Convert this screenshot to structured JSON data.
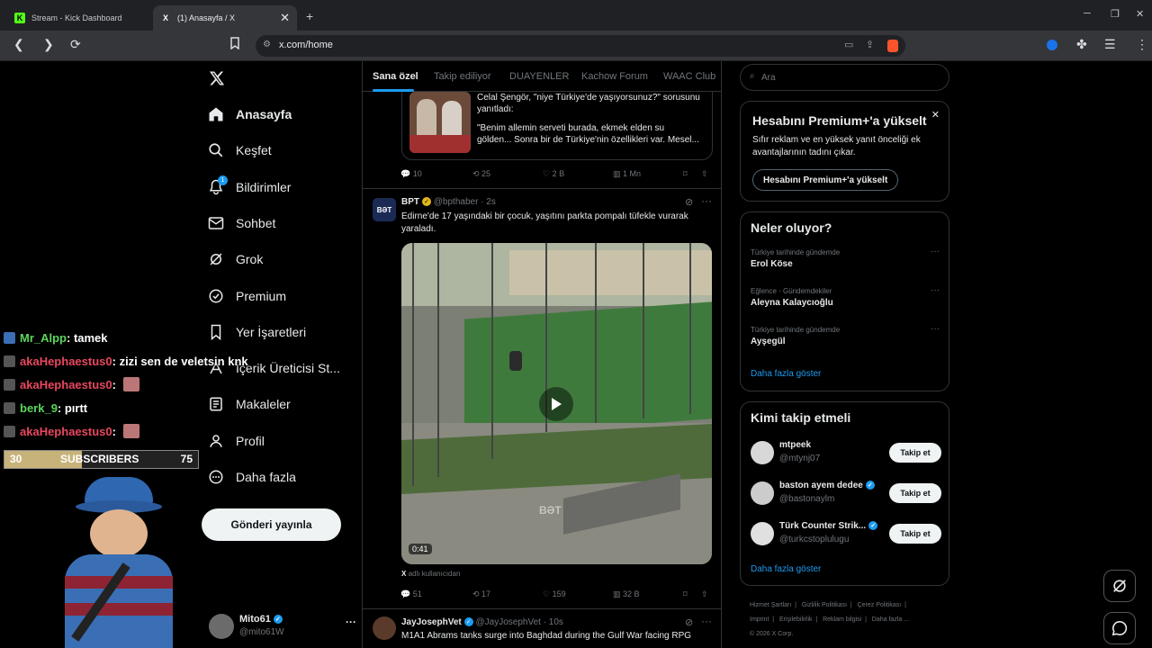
{
  "browser": {
    "tabs": [
      {
        "title": "Stream - Kick Dashboard",
        "favicon": "K",
        "favicon_color": "#53fc18"
      },
      {
        "title": "(1) Anasayfa / X",
        "favicon": "X",
        "favicon_color": "#ffffff"
      }
    ],
    "url": "x.com/home"
  },
  "sidenav": {
    "items": [
      {
        "label": "Anasayfa",
        "icon": "home-icon"
      },
      {
        "label": "Keşfet",
        "icon": "search-icon"
      },
      {
        "label": "Bildirimler",
        "icon": "bell-icon",
        "badge": "1"
      },
      {
        "label": "Sohbet",
        "icon": "mail-icon"
      },
      {
        "label": "Grok",
        "icon": "grok-icon"
      },
      {
        "label": "Premium",
        "icon": "premium-icon"
      },
      {
        "label": "Yer İşaretleri",
        "icon": "bookmark-icon"
      },
      {
        "label": "İçerik Üreticisi St...",
        "icon": "creator-icon"
      },
      {
        "label": "Makaleler",
        "icon": "articles-icon"
      },
      {
        "label": "Profil",
        "icon": "profile-icon"
      },
      {
        "label": "Daha fazla",
        "icon": "more-circle-icon"
      }
    ],
    "post_button": "Gönderi yayınla",
    "me": {
      "name": "Mito61",
      "handle": "@mito61W"
    }
  },
  "feed": {
    "tabs": [
      "Sana özel",
      "Takip ediliyor",
      "DUAYENLER",
      "Kachow Forum",
      "WAAC Club"
    ],
    "tweet0": {
      "quote_lines": [
        "Celal Şengör, \"niye Türkiye'de yaşıyorsunuz?\" sorusunu",
        "yanıtladı:",
        "\"Benim allemin serveti burada, ekmek elden su",
        "gölden... Sonra bir de Türkiye'nin özellikleri var. Mesel..."
      ],
      "replies": "10",
      "reposts": "25",
      "likes": "2 B",
      "views": "1 Mn"
    },
    "tweet1": {
      "name": "BPT",
      "handle": "@bpthaber · 2s",
      "avatar_text": "BƏT",
      "text": "Edirne'de 17 yaşındaki bir çocuk, yaşıtını parkta pompalı tüfekle vurarak yaraladı.",
      "video_duration": "0:41",
      "watermark": "BƏT",
      "source_prefix": "X",
      "source": "adlı kullanıcıdan",
      "replies": "51",
      "reposts": "17",
      "likes": "159",
      "views": "32 B"
    },
    "tweet2": {
      "name": "JayJosephVet",
      "handle": "@JayJosephVet · 10s",
      "text": "M1A1 Abrams tanks surge into Baghdad during the Gulf War facing RPG"
    }
  },
  "right": {
    "search_placeholder": "Ara",
    "premium": {
      "title": "Hesabını Premium+'a yükselt",
      "body": "Sıfır reklam ve en yüksek yanıt önceliği ek avantajlarının tadını çıkar.",
      "button": "Hesabını Premium+'a yükselt"
    },
    "trends": {
      "title": "Neler oluyor?",
      "items": [
        {
          "context": "Türkiye tarihinde gündemde",
          "name": "Erol Köse"
        },
        {
          "context": "Eğlence · Gündemdekiler",
          "name": "Aleyna Kalaycıoğlu"
        },
        {
          "context": "Türkiye tarihinde gündemde",
          "name": "Ayşegül"
        }
      ],
      "more": "Daha fazla göster"
    },
    "who_to_follow": {
      "title": "Kimi takip etmeli",
      "items": [
        {
          "name": "mtpeek",
          "handle": "@mtynj07",
          "button": "Takip et"
        },
        {
          "name": "baston ayem dedee",
          "handle": "@bastonaylm",
          "button": "Takip et"
        },
        {
          "name": "Türk Counter Strik...",
          "handle": "@turkcstoplulugu",
          "button": "Takip et"
        }
      ],
      "more": "Daha fazla göster"
    },
    "footer": [
      "Hizmet Şartları",
      "Gizlilik Politikası",
      "Çerez Politikası",
      "Imprint",
      "Erişilebilirlik",
      "Reklam bilgisi",
      "Daha fazla ...",
      "© 2026 X Corp."
    ]
  },
  "overlay": {
    "chat": [
      {
        "user": "Mr_Alpp",
        "msg": " : tamek",
        "color": "#5cd65c"
      },
      {
        "user": "akaHephaestus0",
        "msg": " : zizi sen de veletsin knk",
        "color": "#e8475f"
      },
      {
        "user": "akaHephaestus0",
        "msg": " :",
        "color": "#e8475f"
      },
      {
        "user": "berk_9",
        "msg": " : pırtt",
        "color": "#5cd65c"
      },
      {
        "user": "akaHephaestus0",
        "msg": " :",
        "color": "#e8475f"
      }
    ],
    "subscribers": {
      "current": "30",
      "label": "SUBSCRIBERS",
      "goal": "75",
      "progress": 0.4
    }
  }
}
